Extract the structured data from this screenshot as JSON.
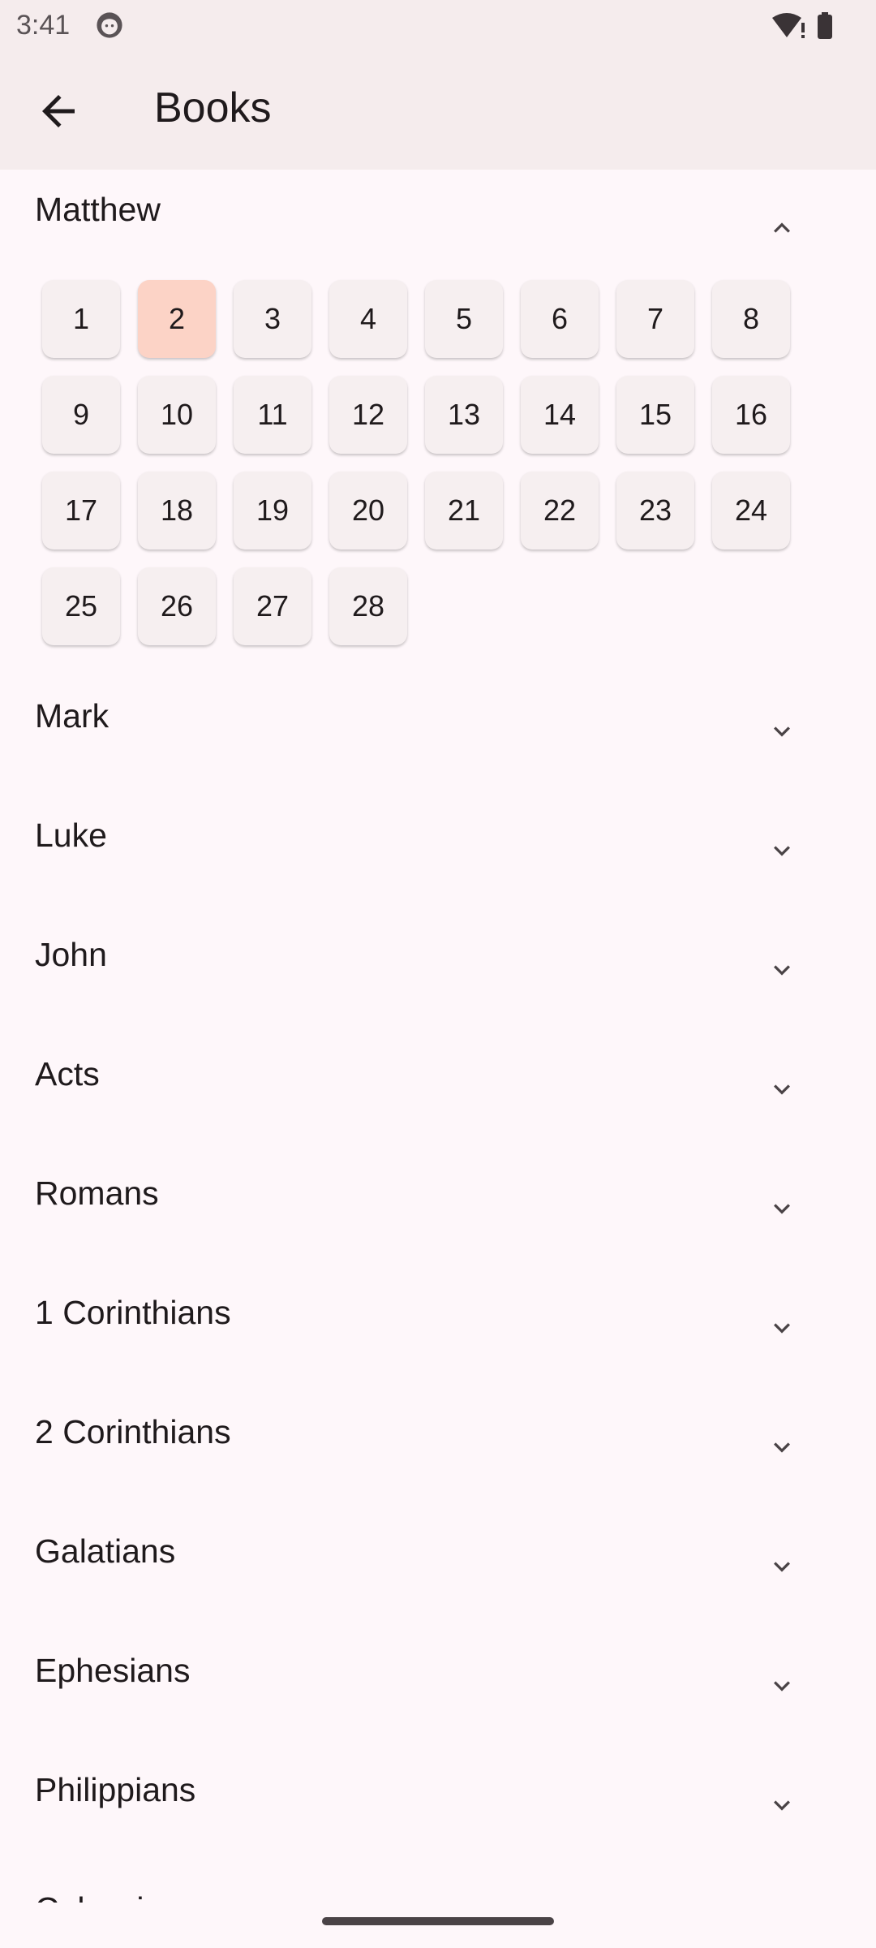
{
  "status_bar": {
    "time": "3:41"
  },
  "app_bar": {
    "title": "Books"
  },
  "expanded_book": {
    "name": "Matthew",
    "selected_chapter": "2",
    "chapters": [
      "1",
      "2",
      "3",
      "4",
      "5",
      "6",
      "7",
      "8",
      "9",
      "10",
      "11",
      "12",
      "13",
      "14",
      "15",
      "16",
      "17",
      "18",
      "19",
      "20",
      "21",
      "22",
      "23",
      "24",
      "25",
      "26",
      "27",
      "28"
    ]
  },
  "books": [
    "Mark",
    "Luke",
    "John",
    "Acts",
    "Romans",
    "1 Corinthians",
    "2 Corinthians",
    "Galatians",
    "Ephesians",
    "Philippians",
    "Colossians"
  ],
  "icons": {
    "back": "arrow-back-icon",
    "expanded": "chevron-up-icon",
    "collapsed": "chevron-down-icon"
  },
  "colors": {
    "app_bar_bg": "#f5eced",
    "page_bg": "#fef7fa",
    "chapter_bg": "#f6eff0",
    "chapter_selected_bg": "#fcd3c6"
  }
}
